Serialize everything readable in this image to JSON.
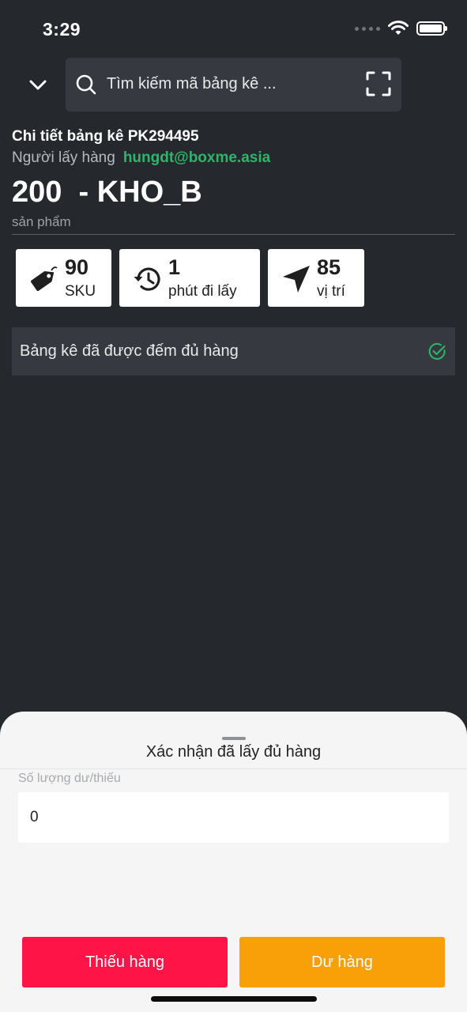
{
  "status_bar": {
    "time": "3:29"
  },
  "search": {
    "placeholder": "Tìm kiếm mã bảng kê ..."
  },
  "detail": {
    "title": "Chi tiết bảng kê PK294495",
    "picker_label": "Người lấy hàng",
    "picker_email": "hungdt@boxme.asia",
    "product_count": "200",
    "warehouse": "  - KHO_B",
    "count_unit": "sản phẩm"
  },
  "stats": [
    {
      "icon": "price-tag-icon",
      "value": "90",
      "label": "SKU"
    },
    {
      "icon": "history-clock-icon",
      "value": "1",
      "label": "phút đi lấy"
    },
    {
      "icon": "navigation-arrow-icon",
      "value": "85",
      "label": "vị trí"
    }
  ],
  "status_message": {
    "text": "Bảng kê đã được đếm đủ hàng",
    "icon": "check-circle-icon"
  },
  "sheet": {
    "title": "Xác nhận đã lấy đủ hàng",
    "qty_label": "Số lượng dư/thiếu",
    "qty_value": "0",
    "short_button": "Thiếu hàng",
    "over_button": "Dư hàng"
  },
  "colors": {
    "background": "#25282c",
    "panel": "#363a40",
    "accent_green": "#2fb56b",
    "danger": "#fe1447",
    "warning": "#f9a009",
    "sheet": "#f4f5f4"
  }
}
